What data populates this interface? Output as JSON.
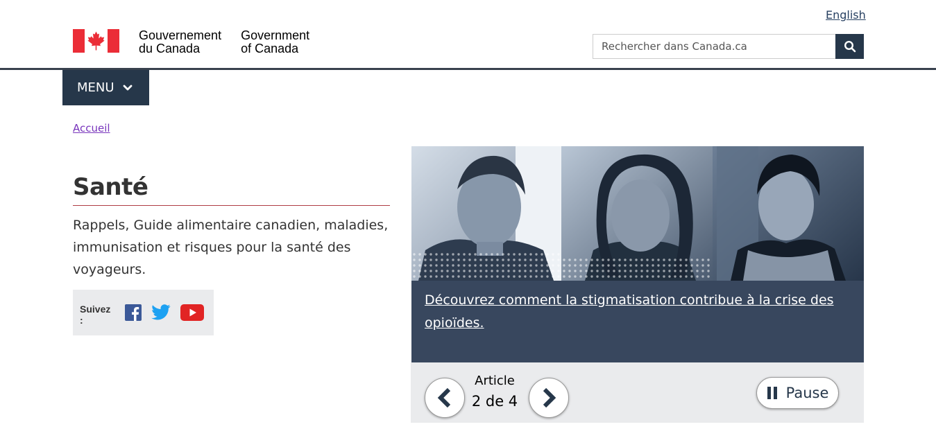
{
  "header": {
    "language_toggle": "English",
    "signature": {
      "fr": [
        "Gouvernement",
        "du Canada"
      ],
      "en": [
        "Government",
        "of Canada"
      ]
    },
    "search": {
      "placeholder": "Rechercher dans Canada.ca",
      "button_icon": "search-icon"
    }
  },
  "nav": {
    "menu_label": "MENU",
    "menu_icon": "chevron-down-icon"
  },
  "breadcrumb": [
    "Accueil"
  ],
  "page": {
    "title": "Santé",
    "intro": "Rappels, Guide alimentaire canadien, maladies, immunisation et risques pour la santé des voyageurs.",
    "follow": {
      "label": "Suivez :",
      "networks": [
        "facebook-icon",
        "twitter-icon",
        "youtube-icon"
      ]
    }
  },
  "feature": {
    "link_text": "Découvrez comment la stigmatisation contribue à la crise des opioïdes.",
    "counter_label": "Article",
    "counter_value": "2 de 4",
    "pause_label": "Pause"
  },
  "colors": {
    "brand_dark": "#26374a",
    "flag_red": "#eb2d37",
    "title_rule": "#af3c43",
    "breadcrumb_link": "#7834bc",
    "caption_bg": "#38475e",
    "panel_bg": "#eaebed"
  }
}
